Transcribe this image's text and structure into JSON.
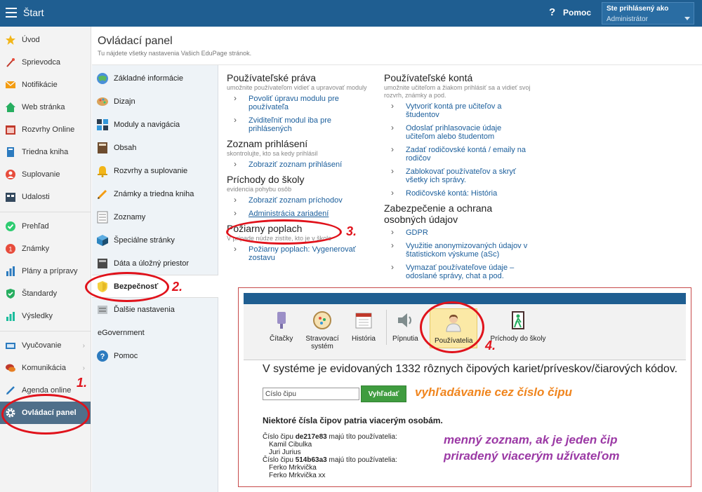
{
  "topbar": {
    "title": "Štart",
    "help_symbol": "?",
    "help_label": "Pomoc",
    "user_label": "Ste prihlásený ako",
    "user_name": "Administrátor",
    "color": "#1f5e91"
  },
  "sidebar": {
    "items": [
      {
        "label": "Úvod",
        "icon": "star-icon"
      },
      {
        "label": "Sprievodca",
        "icon": "wand-icon"
      },
      {
        "label": "Notifikácie",
        "icon": "envelope-icon"
      },
      {
        "label": "Web stránka",
        "icon": "house-icon"
      },
      {
        "label": "Rozvrhy Online",
        "icon": "calendar-icon"
      },
      {
        "label": "Triedna kniha",
        "icon": "book-icon"
      },
      {
        "label": "Suplovanie",
        "icon": "person-icon"
      },
      {
        "label": "Udalosti",
        "icon": "events-icon"
      },
      {
        "label": "Prehľad",
        "icon": "check-circle-icon"
      },
      {
        "label": "Známky",
        "icon": "grades-icon"
      },
      {
        "label": "Plány a prípravy",
        "icon": "plans-icon"
      },
      {
        "label": "Štandardy",
        "icon": "shield-check-icon"
      },
      {
        "label": "Výsledky",
        "icon": "bar-chart-icon"
      },
      {
        "label": "Vyučovanie",
        "icon": "teaching-icon"
      },
      {
        "label": "Komunikácia",
        "icon": "chat-icon"
      },
      {
        "label": "Agenda online",
        "icon": "pen-icon"
      },
      {
        "label": "Ovládací panel",
        "icon": "gear-icon"
      }
    ]
  },
  "header": {
    "title": "Ovládací panel",
    "subtitle": "Tu nájdete všetky nastavenia Vašich EduPage stránok."
  },
  "submenu": {
    "items": [
      {
        "label": "Základné informácie",
        "icon": "info-globe-icon"
      },
      {
        "label": "Dizajn",
        "icon": "palette-icon"
      },
      {
        "label": "Moduly a navigácia",
        "icon": "modules-icon"
      },
      {
        "label": "Obsah",
        "icon": "content-icon"
      },
      {
        "label": "Rozvrhy a suplovanie",
        "icon": "bell-icon"
      },
      {
        "label": "Známky a triedna kniha",
        "icon": "pencil-icon"
      },
      {
        "label": "Zoznamy",
        "icon": "list-icon"
      },
      {
        "label": "Špeciálne stránky",
        "icon": "cube-icon"
      },
      {
        "label": "Dáta a úložný priestor",
        "icon": "storage-icon"
      },
      {
        "label": "Bezpečnosť",
        "icon": "security-shield-icon"
      },
      {
        "label": "Ďalšie nastavenia",
        "icon": "settings-icon"
      },
      {
        "label": "eGovernment",
        "icon": ""
      },
      {
        "label": "Pomoc",
        "icon": "help-icon"
      }
    ]
  },
  "content": {
    "col1": [
      {
        "title": "Používateľské práva",
        "desc": "umožnite používateľom vidieť a upravovať moduly",
        "links": [
          "Povoliť úpravu modulu pre používateľa",
          "Zviditeľniť modul iba pre prihlásených"
        ]
      },
      {
        "title": "Zoznam prihlásení",
        "desc": "skontrolujte, kto sa kedy prihlásil",
        "links": [
          "Zobraziť zoznam prihlásení"
        ]
      },
      {
        "title": "Príchody do školy",
        "desc": "evidencia pohybu osôb",
        "links": [
          "Zobraziť zoznam príchodov",
          "Administrácia zariadení"
        ]
      },
      {
        "title": "Požiarny poplach",
        "desc": "V prípade núdze zistíte, kto je v škole",
        "links": [
          "Požiarny poplach: Vygenerovať zostavu"
        ]
      }
    ],
    "col2": [
      {
        "title": "Používateľské kontá",
        "desc": "umožnite učiteľom a žiakom prihlásiť sa a vidieť svoj rozvrh, známky a pod.",
        "links": [
          "Vytvoriť kontá pre učiteľov a študentov",
          "Odoslať prihlasovacie údaje učiteľom alebo študentom",
          "Zadať rodičovské kontá / emaily na rodičov",
          "Zablokovať používateľov a skryť všetky ich správy.",
          "Rodičovské kontá: História"
        ]
      },
      {
        "title": "Zabezpečenie a ochrana osobných údajov",
        "desc": "",
        "links": [
          "GDPR",
          "Využitie anonymizovaných údajov v štatistickom výskume (aSc)",
          "Vymazať používateľove údaje – odoslané správy, chat a pod."
        ]
      }
    ]
  },
  "overlay": {
    "tools": [
      {
        "label": "Čítačky",
        "icon": "reader-icon"
      },
      {
        "label": "Stravovací systém",
        "icon": "plate-icon"
      },
      {
        "label": "História",
        "icon": "history-calendar-icon"
      },
      {
        "label": "Pípnutia",
        "icon": "speaker-icon"
      },
      {
        "label": "Používatelia",
        "icon": "users-icon"
      },
      {
        "label": "Príchody do školy",
        "icon": "door-icon"
      }
    ],
    "info_text": "V systéme je evidovaných 1332 rôznych čipových kariet/príveskov/čiarových kódov.",
    "search_placeholder": "Číslo čipu",
    "search_button": "Vyhľadať",
    "annotation_search": "vyhľadávanie cez číslo čipu",
    "shared_title": "Niektoré čísla čipov patria viacerým osobám.",
    "chips": [
      {
        "prefix": "Číslo čipu ",
        "code": "de217e83",
        "suffix": " majú títo používatelia:",
        "users": [
          "Kamil Cibulka",
          "Juri Jurius"
        ]
      },
      {
        "prefix": "Číslo čipu ",
        "code": "514b63a3",
        "suffix": " majú títo používatelia:",
        "users": [
          "Ferko Mrkvička",
          "Ferko Mrkvička xx"
        ]
      }
    ],
    "annotation_list": [
      "menný zoznam, ak je jeden čip",
      "priradený viacerým užívateľom"
    ]
  },
  "annotations": {
    "step1": "1.",
    "step2": "2.",
    "step3": "3.",
    "step4": "4.",
    "ring_color": "#e0121b"
  }
}
